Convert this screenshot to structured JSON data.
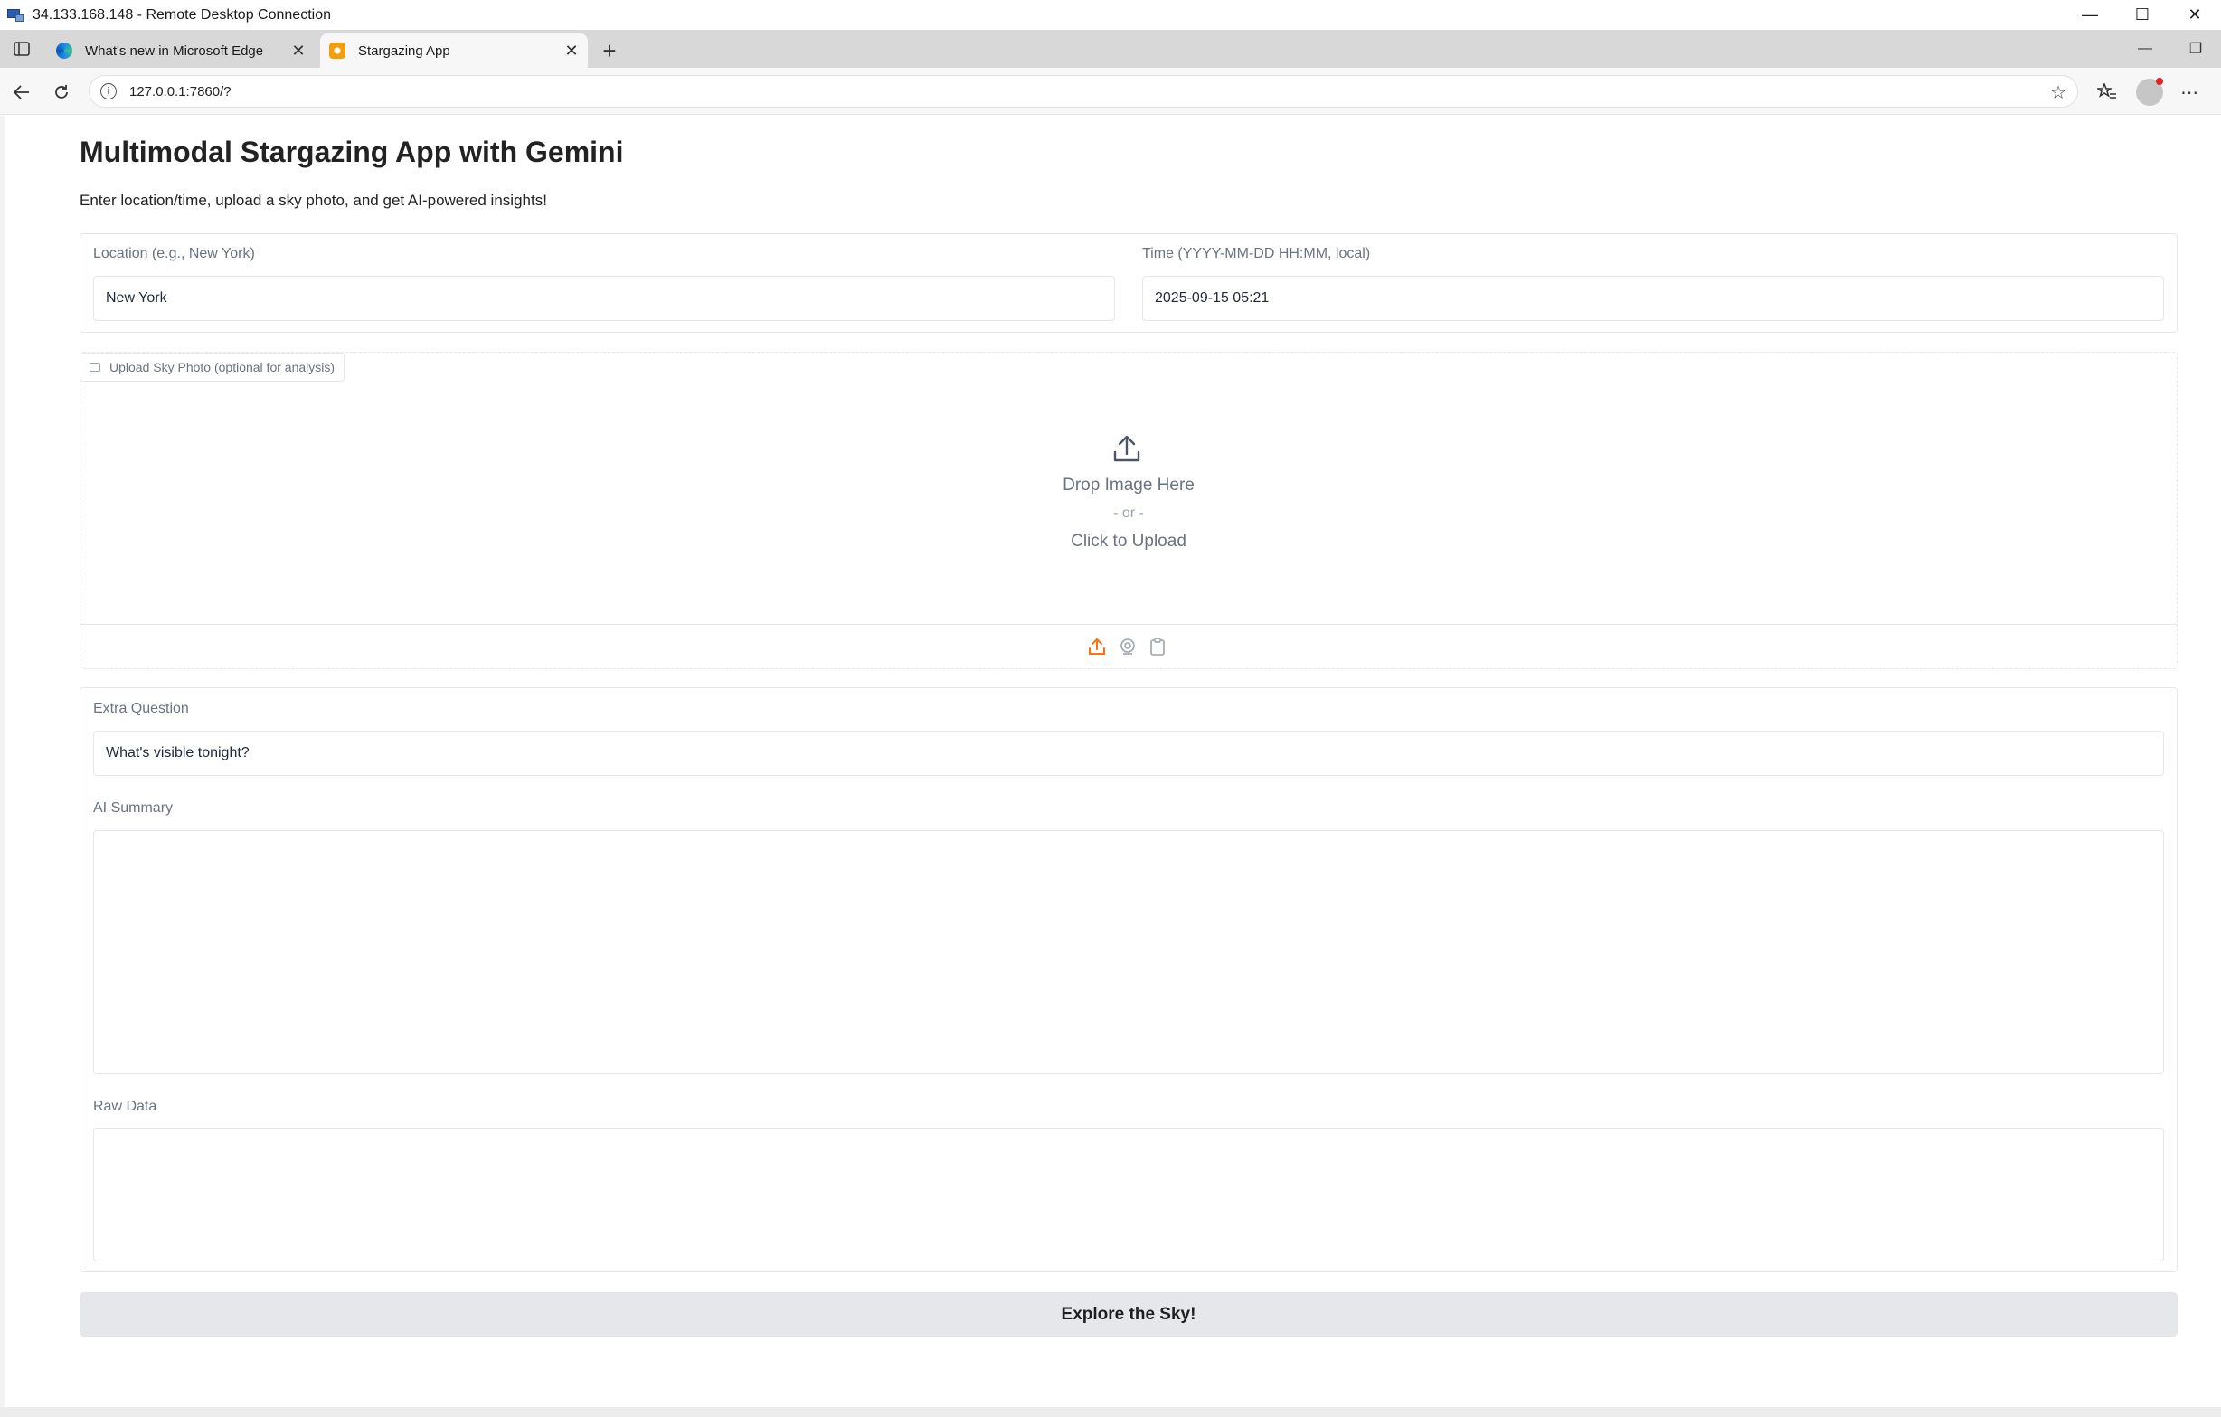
{
  "window": {
    "title": "34.133.168.148 - Remote Desktop Connection"
  },
  "browser": {
    "tabs": [
      {
        "label": "What's new in Microsoft Edge",
        "active": false
      },
      {
        "label": "Stargazing App",
        "active": true
      }
    ],
    "url": "127.0.0.1:7860/?"
  },
  "app": {
    "title": "Multimodal Stargazing App with Gemini",
    "description": "Enter location/time, upload a sky photo, and get AI-powered insights!",
    "location": {
      "label": "Location (e.g., New York)",
      "value": "New York"
    },
    "time": {
      "label": "Time (YYYY-MM-DD HH:MM, local)",
      "value": "2025-09-15 05:21"
    },
    "upload": {
      "label": "Upload Sky Photo (optional for analysis)",
      "drop_text": "Drop Image Here",
      "or_text": "- or -",
      "click_text": "Click to Upload",
      "sources": [
        "upload-icon",
        "webcam-icon",
        "clipboard-icon"
      ],
      "active_source_color": "#f97316"
    },
    "extra_question": {
      "label": "Extra Question",
      "value": "What's visible tonight?"
    },
    "ai_summary": {
      "label": "AI Summary",
      "value": ""
    },
    "raw_data": {
      "label": "Raw Data",
      "value": ""
    },
    "submit_label": "Explore the Sky!"
  }
}
